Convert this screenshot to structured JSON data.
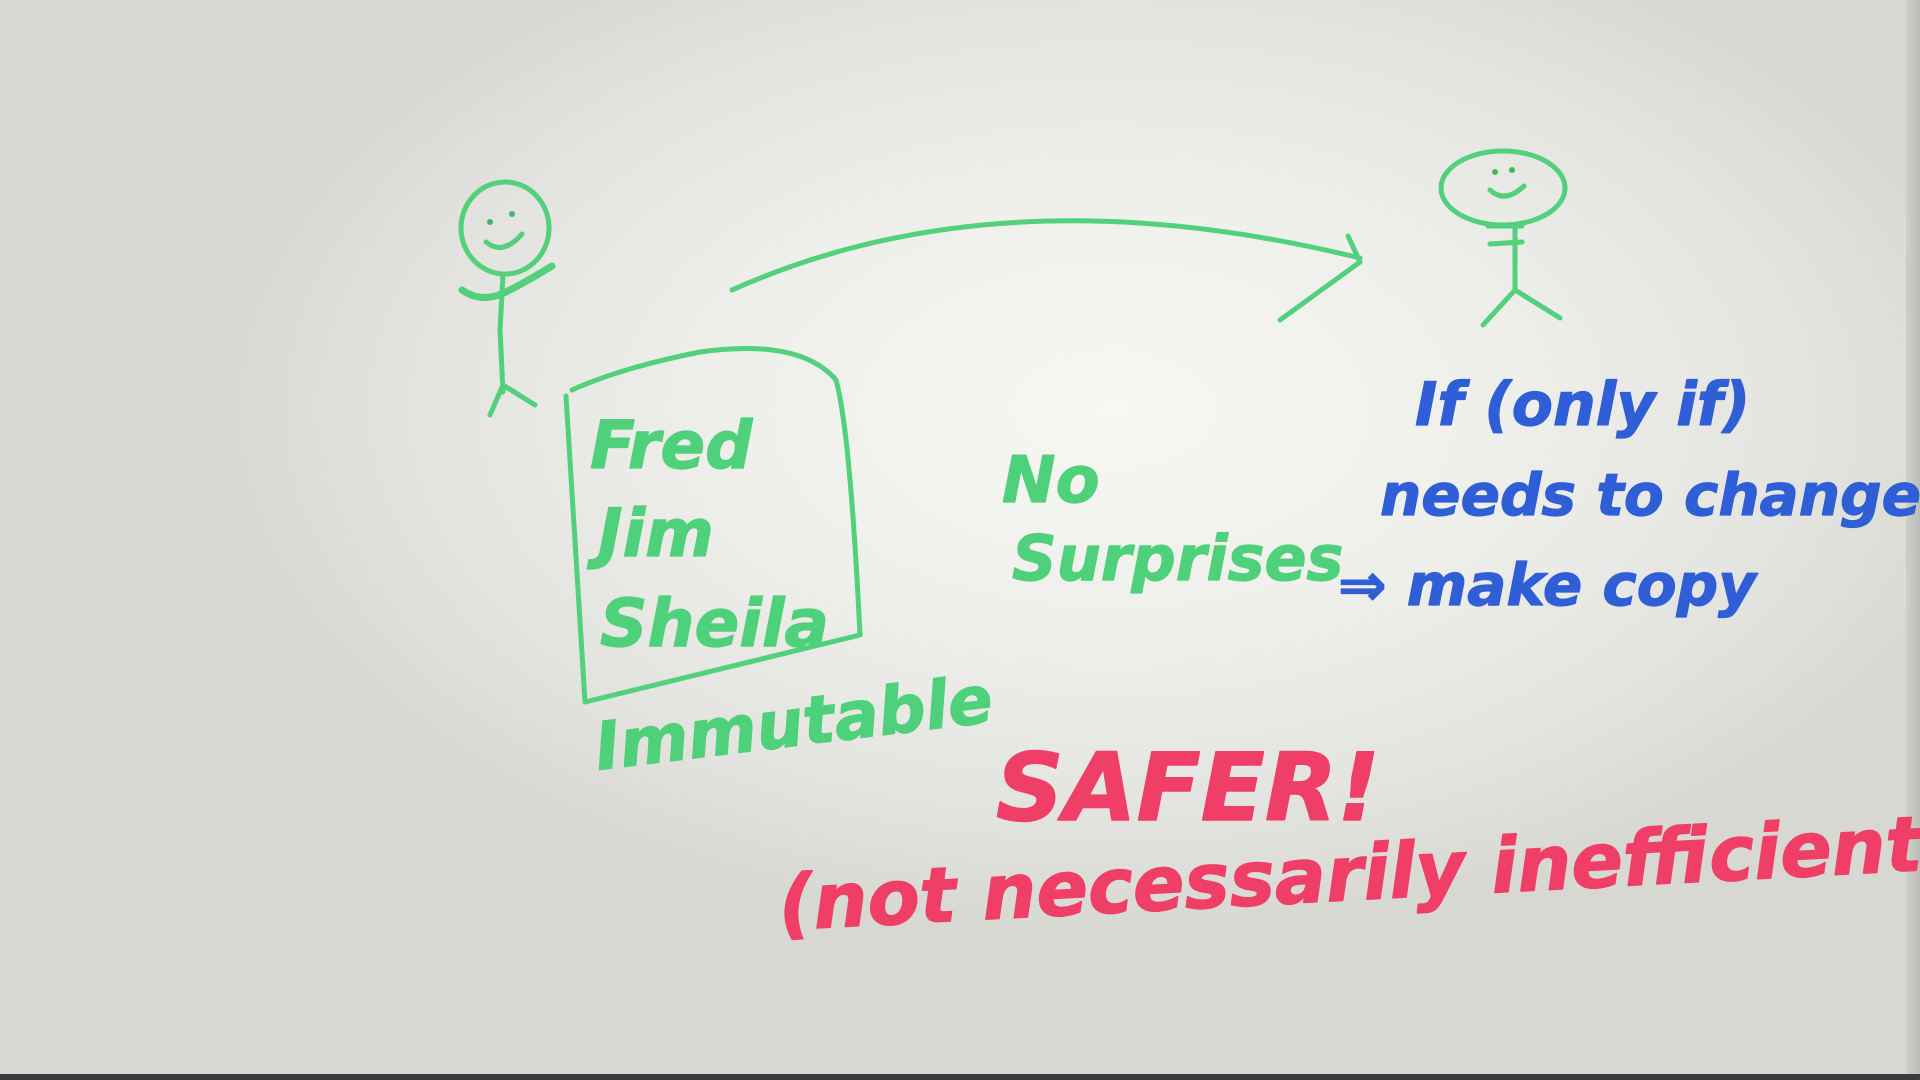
{
  "whiteboard": {
    "list_items": [
      "Fred",
      "Jim",
      "Sheila"
    ],
    "list_caption": "Immutable",
    "middle_note": [
      "No",
      "Surprises"
    ],
    "right_note": [
      "If (only if)",
      "needs to change",
      "⇒ make copy"
    ],
    "conclusion": "SAFER!",
    "conclusion_sub": "(not necessarily inefficient)"
  },
  "colors": {
    "green_marker": "#4fd07a",
    "blue_marker": "#2f5ed6",
    "red_marker": "#ef3f66"
  },
  "icons": [
    "stick-figure-left-icon",
    "stick-figure-right-icon",
    "arrow-icon"
  ]
}
